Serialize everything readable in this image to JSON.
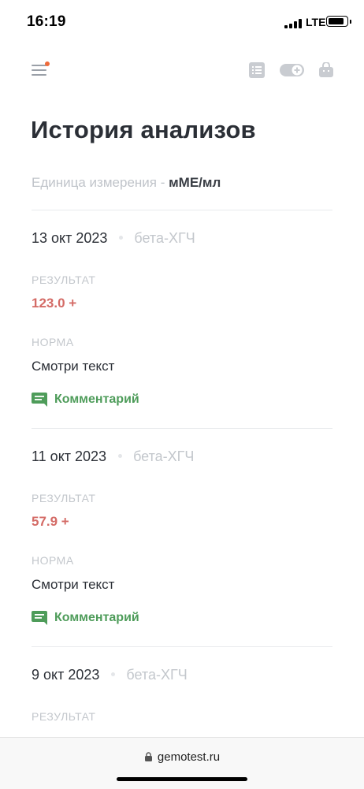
{
  "status_bar": {
    "time": "16:19",
    "network": "LTE"
  },
  "header": {
    "icons": [
      "menu-icon",
      "list-icon",
      "toggle-icon",
      "bag-icon"
    ],
    "menu_badge_color": "#ef6a3a"
  },
  "page": {
    "title": "История анализов",
    "unit_label": "Единица измерения -",
    "unit_value": "мМЕ/мл"
  },
  "records": [
    {
      "date": "13 окт 2023",
      "test": "бета-ХГЧ",
      "result_label": "РЕЗУЛЬТАТ",
      "result": "123.0 +",
      "norm_label": "НОРМА",
      "norm": "Смотри текст",
      "comment": "Комментарий"
    },
    {
      "date": "11 окт 2023",
      "test": "бета-ХГЧ",
      "result_label": "РЕЗУЛЬТАТ",
      "result": "57.9 +",
      "norm_label": "НОРМА",
      "norm": "Смотри текст",
      "comment": "Комментарий"
    },
    {
      "date": "9 окт 2023",
      "test": "бета-ХГЧ",
      "result_label": "РЕЗУЛЬТАТ"
    }
  ],
  "browser": {
    "url": "gemotest.ru"
  },
  "colors": {
    "accent_result": "#d46b66",
    "accent_comment": "#4e9c5a",
    "title": "#2b2f36"
  }
}
